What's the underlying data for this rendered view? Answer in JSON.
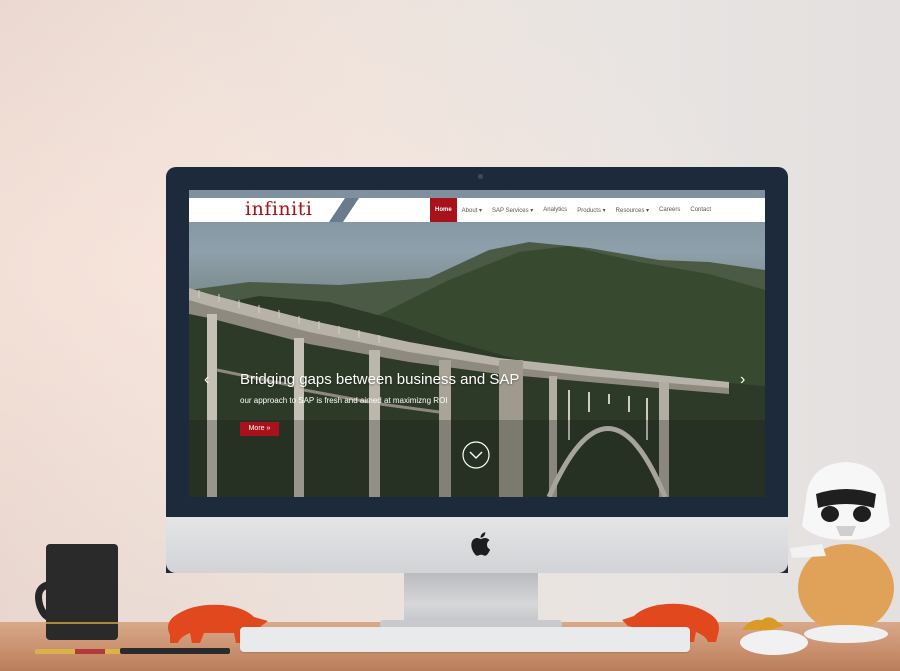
{
  "site": {
    "logo_text": "infiniti",
    "brand_color": "#a8121b",
    "nav": {
      "items": [
        "Home",
        "About ▾",
        "SAP Services ▾",
        "Analytics",
        "Products ▾",
        "Resources ▾",
        "Careers",
        "Contact"
      ],
      "active": "Home"
    },
    "hero": {
      "title": "Bridging gaps between business and SAP",
      "subtitle": "our approach to SAP is fresh and aimed at maximizng ROI",
      "button_label": "More »",
      "arrow_left": "‹",
      "arrow_right": "›"
    }
  }
}
